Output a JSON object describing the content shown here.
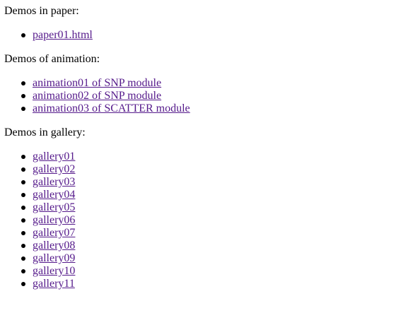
{
  "colors": {
    "link": "#551a8b",
    "text": "#000000",
    "background": "#ffffff"
  },
  "sections": [
    {
      "heading": "Demos in paper:",
      "links": [
        "paper01.html"
      ]
    },
    {
      "heading": "Demos of animation:",
      "links": [
        "animation01 of SNP module",
        "animation02 of SNP module",
        "animation03 of SCATTER module"
      ]
    },
    {
      "heading": "Demos in gallery:",
      "links": [
        "gallery01",
        "gallery02",
        "gallery03",
        "gallery04",
        "gallery05",
        "gallery06",
        "gallery07",
        "gallery08",
        "gallery09",
        "gallery10",
        "gallery11"
      ]
    }
  ]
}
